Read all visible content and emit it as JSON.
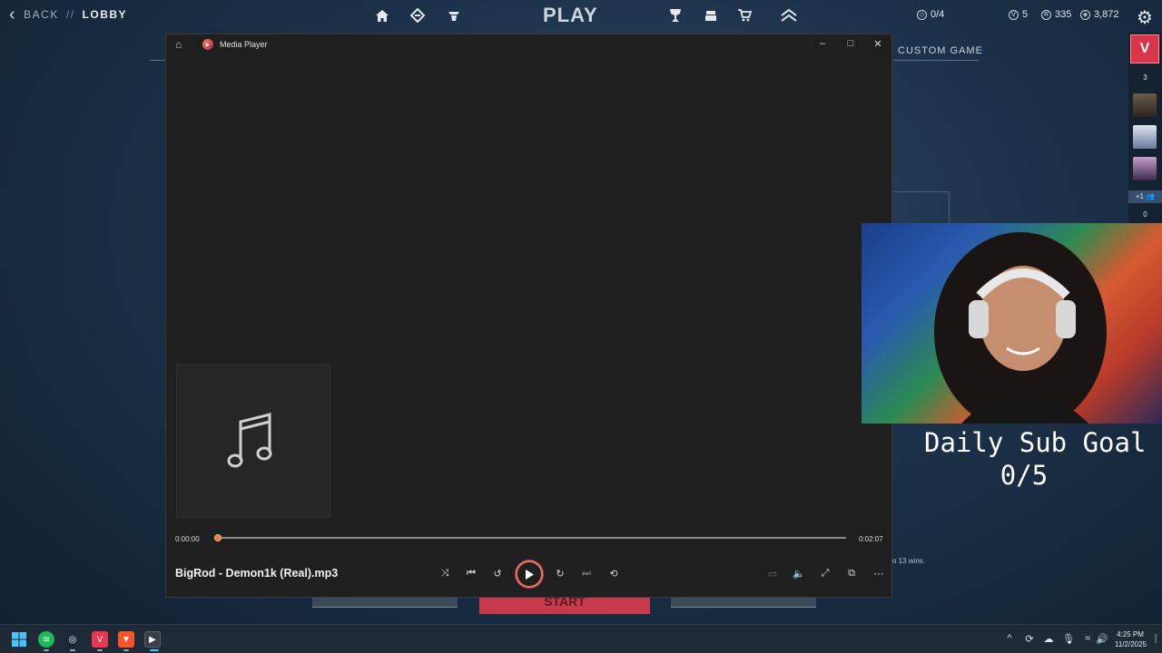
{
  "game": {
    "back_label": "BACK",
    "separator": "//",
    "section": "LOBBY",
    "title": "PLAY",
    "custom_game_label": "CUSTOM GAME",
    "start_label": "START",
    "hint_text": "o 13 wins.",
    "currencies": [
      {
        "icon": "kingdom-credits-icon",
        "value": "0/4"
      },
      {
        "icon": "valorant-points-icon",
        "value": "5"
      },
      {
        "icon": "radianite-icon",
        "value": "335"
      },
      {
        "icon": "vp-icon",
        "value": "3,872"
      }
    ],
    "accent_color": "#c7394b"
  },
  "rail": {
    "party_count": "3",
    "more_label": "+1",
    "bottom_count": "0"
  },
  "player": {
    "app_name": "Media Player",
    "elapsed": "0:00:00",
    "duration": "0:02:07",
    "progress": 0.0,
    "track_title": "BigRod - Demon1k (Real).mp3",
    "accent_color": "#f07c3a"
  },
  "overlay": {
    "goal_label": "Daily Sub Goal",
    "goal_count": "0/5"
  },
  "taskbar": {
    "time": "4:25 PM",
    "date": "11/2/2025"
  }
}
